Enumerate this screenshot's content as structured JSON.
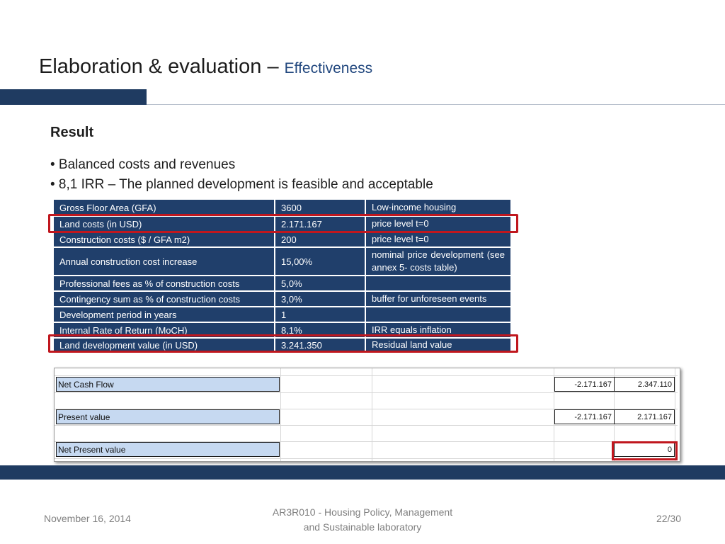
{
  "slide": {
    "title_main": "Elaboration & evaluation –",
    "title_sub": "Effectiveness",
    "result_heading": "Result",
    "bullets": [
      "• Balanced costs and revenues",
      "• 8,1 IRR –  The planned development is feasible and acceptable"
    ]
  },
  "parameters_table": {
    "rows": [
      {
        "label": "Gross Floor Area (GFA)",
        "value": "3600",
        "note": "Low-income housing",
        "highlighted": false
      },
      {
        "label": "Land costs (in USD)",
        "value": "2.171.167",
        "note": "price level t=0",
        "highlighted": true
      },
      {
        "label": "Construction costs ($ / GFA  m2)",
        "value": "200",
        "note": "price level t=0",
        "highlighted": false
      },
      {
        "label": "Annual construction cost increase",
        "value": "15,00%",
        "note": "nominal price development (see annex 5- costs table)",
        "highlighted": false
      },
      {
        "label": "Professional fees as % of construction costs",
        "value": "5,0%",
        "note": "",
        "highlighted": false
      },
      {
        "label": "Contingency sum as % of construction costs",
        "value": "3,0%",
        "note": "buffer for unforeseen events",
        "highlighted": false
      },
      {
        "label": "Development period in years",
        "value": "1",
        "note": "",
        "highlighted": false
      },
      {
        "label": "Internal Rate of Return (MoCH)",
        "value": "8,1%",
        "note": "IRR equals inflation",
        "highlighted": false
      },
      {
        "label": "Land development value (in USD)",
        "value": "3.241.350",
        "note": "Residual land value",
        "highlighted": true
      }
    ]
  },
  "cash_flow_table": {
    "rows": [
      {
        "label": "Net Cash Flow",
        "value_t0": "-2.171.167",
        "value_t1": "2.347.110"
      },
      {
        "label": "Present value",
        "value_t0": "-2.171.167",
        "value_t1": "2.171.167"
      },
      {
        "label": "Net Present value",
        "value_t0": "",
        "value_t1": "0"
      }
    ],
    "highlight_color": "#c0171e"
  },
  "footer": {
    "date": "November 16, 2014",
    "course_line1": "AR3R010 - Housing Policy, Management",
    "course_line2": "and Sustainable laboratory",
    "page": "22/30"
  },
  "colors": {
    "navy": "#1f3b61",
    "table_bg": "#203f6b",
    "label_fill": "#c6d9f1",
    "highlight": "#c0171e"
  }
}
